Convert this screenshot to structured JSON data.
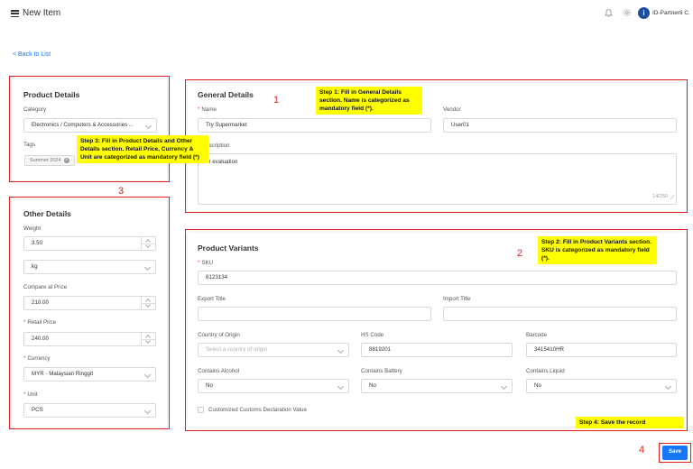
{
  "header": {
    "title": "New Item",
    "company": "ID-Partner8 C."
  },
  "back_link": "< Back to List",
  "product_details": {
    "title": "Product Details",
    "category_label": "Category",
    "category_value": "Electronics / Computers & Accessories ...",
    "tags_label": "Tags",
    "tag": "Summer 2024"
  },
  "other_details": {
    "title": "Other Details",
    "weight_label": "Weight",
    "weight_value": "3.50",
    "weight_unit": "kg",
    "compare_label": "Compare at Price",
    "compare_value": "210.00",
    "retail_label": "Retail Price",
    "retail_value": "240.00",
    "currency_label": "Currency",
    "currency_value": "MYR - Malaysian Ringgit",
    "unit_label": "Unit",
    "unit_value": "PCS"
  },
  "general_details": {
    "title": "General Details",
    "name_label": "Name",
    "name_value": "Try Supermarket",
    "vendor_label": "Vendor",
    "vendor_value": "User01",
    "description_label": "escription",
    "description_value": "or evaluation",
    "char_count": "14/250"
  },
  "product_variants": {
    "title": "Product Variants",
    "sku_label": "SKU",
    "sku_value": "8123134",
    "export_label": "Export Title",
    "import_label": "Import Title",
    "origin_label": "Country of Origin",
    "origin_placeholder": "Select a country of origin",
    "hs_label": "HS Code",
    "hs_value": "8819201",
    "barcode_label": "Barcode",
    "barcode_value": "3415410HR",
    "alcohol_label": "Contains Alcohol",
    "alcohol_value": "No",
    "battery_label": "Contains Battery",
    "battery_value": "No",
    "liquid_label": "Contains Liquid",
    "liquid_value": "No",
    "customs_label": "Customized Customs Declaration Value"
  },
  "annotations": {
    "step1": "Step 1: Fill in General Details section. Name is categorized as mandatory field (*).",
    "step2": "Step 2: Fill in Product Variants section. SKU is categorized as mandatory field (*).",
    "step3": "Step 3: Fill in Product Details and Other Details section. Retail Price, Currency & Unit are categorized as mandatory field (*)",
    "step4": "Step 4: Save the record",
    "n1": "1",
    "n2": "2",
    "n3": "3",
    "n4": "4"
  },
  "save_label": "Save",
  "required_mark": "*",
  "colors": {
    "accent": "#1677ff",
    "annotation_box": "#e02020",
    "note_bg": "#ffff00"
  }
}
